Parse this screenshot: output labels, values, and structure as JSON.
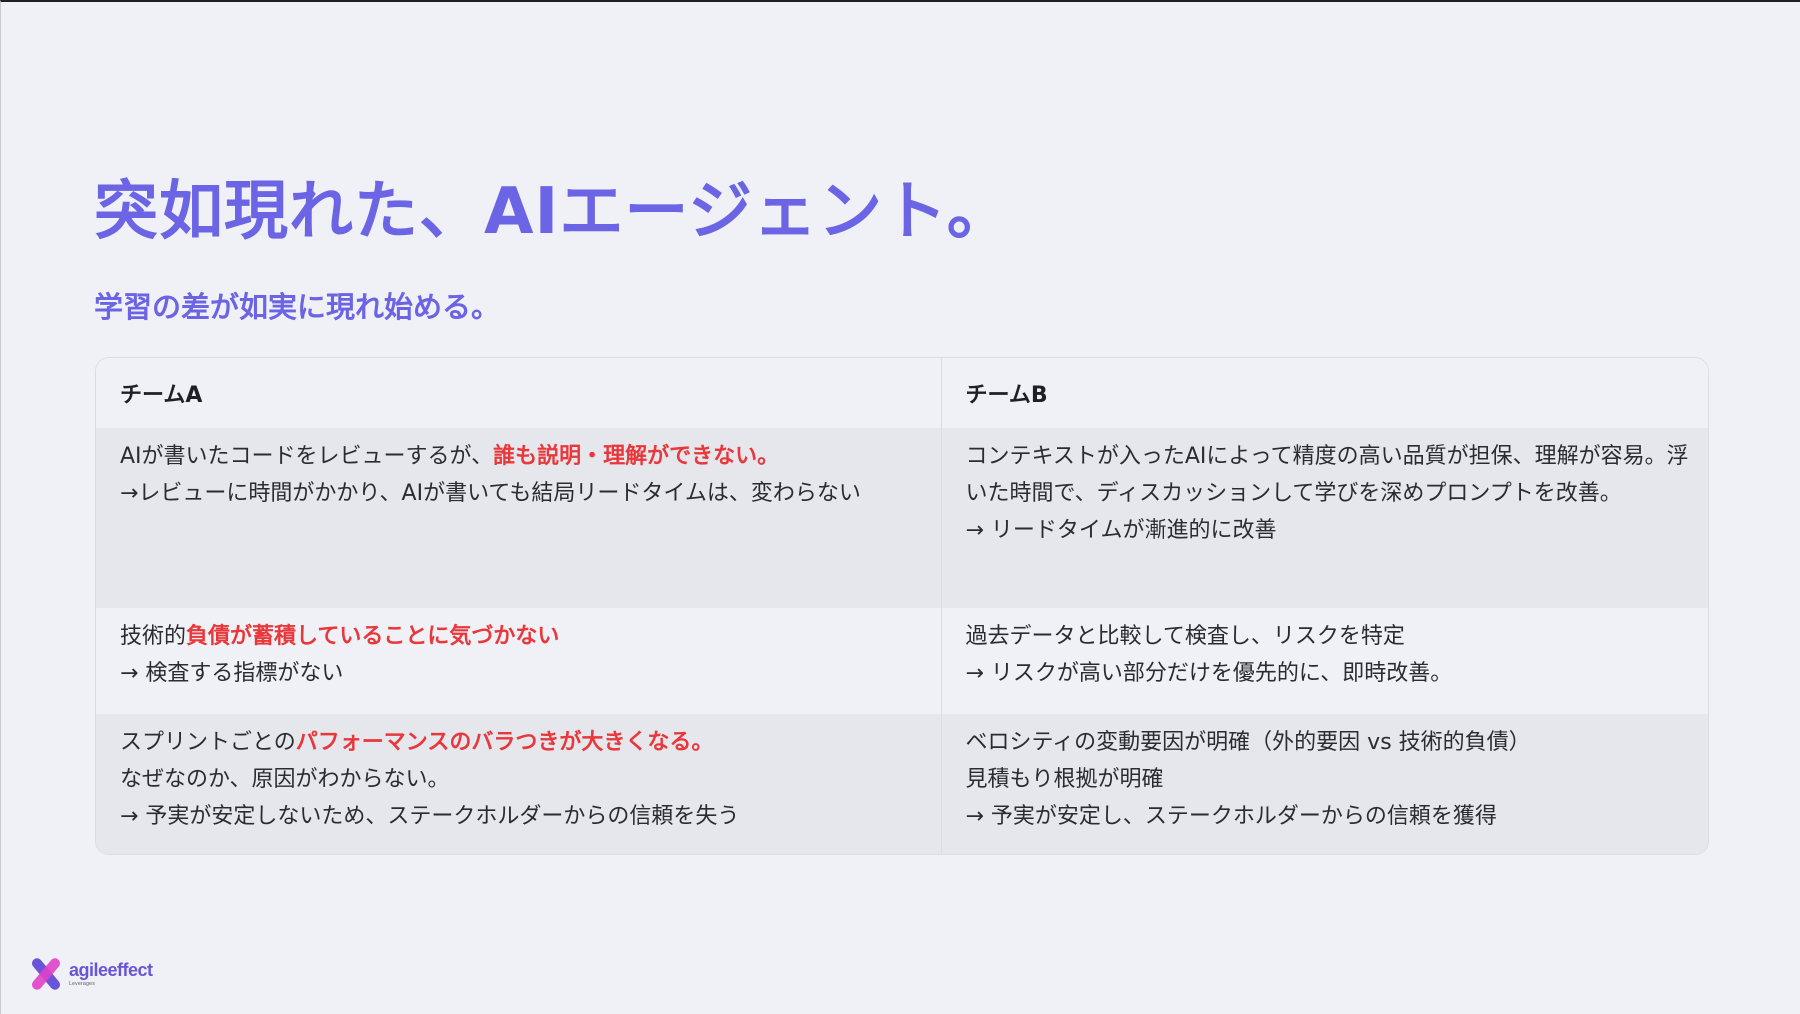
{
  "slide": {
    "title": "突如現れた、AIエージェント。",
    "subtitle": "学習の差が如実に現れ始める。"
  },
  "table": {
    "headers": [
      "チームA",
      "チームB"
    ],
    "rows": [
      {
        "a": [
          {
            "plain": "AIが書いたコードをレビューするが、",
            "highlight": "誰も説明・理解ができない。"
          },
          {
            "plain": "→レビューに時間がかかり、AIが書いても結局リードタイムは、変わらない"
          }
        ],
        "b": [
          {
            "plain": "コンテキストが入ったAIによって精度の高い品質が担保、理解が容易。浮いた時間で、ディスカッションして学びを深めプロンプトを改善。"
          },
          {
            "plain": "→ リードタイムが漸進的に改善"
          }
        ]
      },
      {
        "a": [
          {
            "plain": "技術的",
            "highlight": "負債が蓄積していることに気づかない"
          },
          {
            "plain": "→ 検査する指標がない"
          }
        ],
        "b": [
          {
            "plain": "過去データと比較して検査し、リスクを特定"
          },
          {
            "plain": "→ リスクが高い部分だけを優先的に、即時改善。"
          }
        ]
      },
      {
        "a": [
          {
            "plain": "スプリントごとの",
            "highlight": "パフォーマンスのバラつきが大きくなる。"
          },
          {
            "plain": "なぜなのか、原因がわからない。"
          },
          {
            "plain": "→ 予実が安定しないため、ステークホルダーからの信頼を失う"
          }
        ],
        "b": [
          {
            "plain": "ベロシティの変動要因が明確（外的要因 vs 技術的負債）"
          },
          {
            "plain": "見積もり根拠が明確"
          },
          {
            "plain": "→ 予実が安定し、ステークホルダーからの信頼を獲得"
          }
        ]
      }
    ]
  },
  "logo": {
    "name": "agileeffect",
    "tagline": "Leverages",
    "icon": "x-mark-logo-icon",
    "colors": {
      "primary": "#6a55d8",
      "accent": "#e040c8"
    }
  },
  "colors": {
    "title": "#6b64e4",
    "highlight": "#e8383b",
    "background": "#f0f1f6",
    "row_shade": "#e6e7ec"
  }
}
